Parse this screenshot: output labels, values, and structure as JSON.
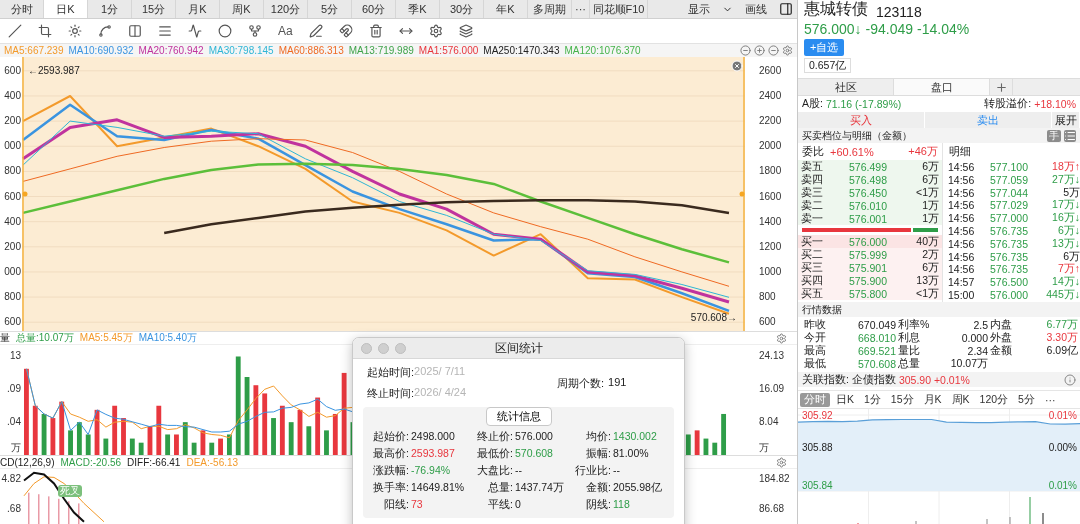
{
  "top_tabs": {
    "tabs": [
      {
        "label": "分时",
        "selected": false,
        "kind": "period"
      },
      {
        "label": "日K",
        "selected": true,
        "kind": "period"
      },
      {
        "label": "1分",
        "selected": false,
        "kind": "period"
      },
      {
        "label": "15分",
        "selected": false,
        "kind": "period"
      },
      {
        "label": "月K",
        "selected": false,
        "kind": "period"
      },
      {
        "label": "周K",
        "selected": false,
        "kind": "period"
      },
      {
        "label": "120分",
        "selected": false,
        "kind": "period"
      },
      {
        "label": "5分",
        "selected": false,
        "kind": "period"
      },
      {
        "label": "60分",
        "selected": false,
        "kind": "period"
      },
      {
        "label": "季K",
        "selected": false,
        "kind": "period"
      },
      {
        "label": "30分",
        "selected": false,
        "kind": "period"
      },
      {
        "label": "年K",
        "selected": false,
        "kind": "period"
      },
      {
        "label": "多周期",
        "selected": false,
        "kind": "period"
      },
      {
        "label": "···",
        "selected": false,
        "kind": "more"
      },
      {
        "label": "同花顺F10",
        "selected": false,
        "kind": "link"
      }
    ],
    "display_menu": "显示",
    "draw_lines": "画线"
  },
  "drawing_tools": {
    "text_tool": "Aa"
  },
  "ma_legend": [
    "MA5:667.239",
    "MA10:690.932",
    "MA20:760.942",
    "MA30:798.145",
    "MA60:886.313",
    "MA13:719.989",
    "MA1:576.000",
    "MA250:1470.343",
    "MA120:1076.370"
  ],
  "main_chart": {
    "left_axis_labels": [
      "600",
      "400",
      "200",
      "000",
      "800",
      "600",
      "400",
      "200",
      "000",
      "800",
      "600"
    ],
    "chart_data": {
      "type": "line",
      "grid": true,
      "ylim": [
        530,
        2710
      ],
      "yticks": [
        600,
        800,
        1000,
        1200,
        1400,
        1600,
        1800,
        2000,
        2200,
        2400,
        2600
      ],
      "series": [
        {
          "color": "#f39a2b",
          "values": [
            2200,
            2400,
            2000,
            2070,
            2140,
            2000,
            1820,
            1560,
            1470,
            1330,
            1130,
            1300,
            950,
            940,
            800,
            667
          ]
        },
        {
          "color": "#3a94e0",
          "values": [
            2050,
            2330,
            2080,
            2050,
            2130,
            2060,
            1850,
            1640,
            1500,
            1380,
            1250,
            1260,
            990,
            960,
            830,
            691
          ]
        },
        {
          "color": "#c0339e",
          "values": [
            1900,
            2150,
            2210,
            2070,
            2080,
            2100,
            2000,
            1800,
            1620,
            1500,
            1300,
            1260,
            1000,
            970,
            870,
            761
          ]
        },
        {
          "color": "#2fb6d6",
          "values": [
            1850,
            2200,
            2150,
            2080,
            2120,
            2100,
            1900,
            1750,
            1560,
            1450,
            1300,
            1250,
            1010,
            980,
            900,
            798
          ]
        },
        {
          "color": "#ef6a23",
          "values": [
            1720,
            1820,
            1920,
            1990,
            2040,
            2060,
            2050,
            1950,
            1800,
            1620,
            1470,
            1360,
            1260,
            1120,
            1000,
            886
          ]
        },
        {
          "color": "#5cbf3a",
          "values": [
            1470,
            1560,
            1650,
            1740,
            1810,
            1855,
            1860,
            1850,
            1820,
            1770,
            1700,
            1560,
            1430,
            1300,
            1180,
            1076
          ]
        },
        {
          "color": "#3a2a1e",
          "values": [
            null,
            null,
            null,
            1310,
            1380,
            1430,
            1480,
            1510,
            1535,
            1555,
            1565,
            1570,
            1570,
            1560,
            1530,
            1470
          ]
        }
      ],
      "annotations": [
        "←2593.987",
        "570.608→"
      ]
    }
  },
  "volume": {
    "title": "量",
    "legend": [
      "总量:10.07万",
      "MA5:5.45万",
      "MA10:5.40万"
    ],
    "left_axis_labels": [
      "13",
      ".09",
      ".04",
      "万"
    ],
    "right_axis_labels": [
      "24.13",
      "16.09",
      "8.04",
      "万"
    ]
  },
  "macd": {
    "title": "CD(12,26,9)",
    "legend": [
      "MACD:-20.56",
      "DIFF:-66.41",
      "DEA:-56.13"
    ],
    "left_axis_labels": [
      "4.82",
      ".68"
    ],
    "right_axis_labels": [
      "184.82",
      "86.68"
    ],
    "signal_badge": "死叉"
  },
  "interval_dialog": {
    "title": "区间统计",
    "start_label": "起始时间:",
    "start_value": "2025/ 7/11",
    "end_label": "终止时间:",
    "end_value": "2026/ 4/24",
    "count_label": "周期个数:",
    "count_value": "191",
    "stats_button": "统计信息",
    "rows": [
      {
        "cells": [
          {
            "label": "起始价:",
            "value": "2498.000",
            "kind": "flat"
          },
          {
            "label": "终止价:",
            "value": "576.000",
            "kind": "flat"
          },
          {
            "label": "均价:",
            "value": "1430.002",
            "kind": "down"
          }
        ]
      },
      {
        "cells": [
          {
            "label": "最高价:",
            "value": "2593.987",
            "kind": "up"
          },
          {
            "label": "最低价:",
            "value": "570.608",
            "kind": "down"
          },
          {
            "label": "振幅:",
            "value": "81.00%",
            "kind": "flat"
          }
        ]
      },
      {
        "cells": [
          {
            "label": "涨跌幅:",
            "value": "-76.94%",
            "kind": "down"
          },
          {
            "label": "大盘比:",
            "value": "--",
            "kind": "flat"
          },
          {
            "label": "行业比:",
            "value": "--",
            "kind": "flat"
          }
        ]
      },
      {
        "cells": [
          {
            "label": "换手率:",
            "value": "14649.81%",
            "kind": "flat"
          },
          {
            "label": "总量:",
            "value": "1437.74万",
            "kind": "flat"
          },
          {
            "label": "金额:",
            "value": "2055.98亿",
            "kind": "flat"
          }
        ]
      },
      {
        "cells": [
          {
            "label": "阳线:",
            "value": "73",
            "kind": "up"
          },
          {
            "label": "平线:",
            "value": "0",
            "kind": "flat"
          },
          {
            "label": "阴线:",
            "value": "118",
            "kind": "down"
          }
        ]
      }
    ]
  },
  "quote": {
    "name": "惠城转债",
    "code": "123118",
    "price": {
      "value": "576.000↓",
      "change": "-94.049",
      "pct": "-14.04%",
      "kind": "down"
    },
    "watch_button": "+自选",
    "market_cap": "0.657亿",
    "tabs": [
      {
        "label": "社区",
        "selected": false
      },
      {
        "label": "盘口",
        "selected": true
      }
    ],
    "stock_line": {
      "label": "A股:",
      "value": "71.16 (-17.89%)",
      "kind": "down"
    },
    "premium": {
      "label": "转股溢价:",
      "value": "+18.10%",
      "kind": "up"
    },
    "trade_buttons": [
      {
        "label": "买入",
        "kind": "buy"
      },
      {
        "label": "卖出",
        "kind": "sell"
      },
      {
        "label": "展开",
        "kind": "plain"
      }
    ],
    "book_title": "买卖档位与明细（金额）",
    "lot_toggle": "手",
    "order_ratio": {
      "label": "委比",
      "pct": "+60.61%",
      "amount": "+46万",
      "kind": "up"
    },
    "detail_title": "明细",
    "asks": [
      {
        "label": "卖五",
        "price": "576.499",
        "volume": "6万"
      },
      {
        "label": "卖四",
        "price": "576.498",
        "volume": "6万"
      },
      {
        "label": "卖三",
        "price": "576.450",
        "volume": "<1万"
      },
      {
        "label": "卖二",
        "price": "576.010",
        "volume": "1万"
      },
      {
        "label": "卖一",
        "price": "576.001",
        "volume": "1万"
      }
    ],
    "bid_share": {
      "level": 0.8
    },
    "bids": [
      {
        "label": "买一",
        "price": "576.000",
        "volume": "40万"
      },
      {
        "label": "买二",
        "price": "575.999",
        "volume": "2万"
      },
      {
        "label": "买三",
        "price": "575.901",
        "volume": "6万"
      },
      {
        "label": "买四",
        "price": "575.900",
        "volume": "13万"
      },
      {
        "label": "买五",
        "price": "575.800",
        "volume": "<1万"
      }
    ],
    "trades": [
      {
        "time": "14:56",
        "price": "577.100",
        "volume": "18万",
        "arrow": "↑",
        "kind": "up"
      },
      {
        "time": "14:56",
        "price": "577.059",
        "volume": "27万",
        "arrow": "↓",
        "kind": "down"
      },
      {
        "time": "14:56",
        "price": "577.044",
        "volume": "5万",
        "kind": "flat"
      },
      {
        "time": "14:56",
        "price": "577.029",
        "volume": "17万",
        "arrow": "↓",
        "kind": "down"
      },
      {
        "time": "14:56",
        "price": "577.000",
        "volume": "16万",
        "arrow": "↓",
        "kind": "down"
      },
      {
        "time": "14:56",
        "price": "576.735",
        "volume": "6万",
        "arrow": "↓",
        "kind": "down"
      },
      {
        "time": "14:56",
        "price": "576.735",
        "volume": "13万",
        "arrow": "↓",
        "kind": "down"
      },
      {
        "time": "14:56",
        "price": "576.735",
        "volume": "6万",
        "kind": "flat"
      },
      {
        "time": "14:56",
        "price": "576.735",
        "volume": "7万",
        "arrow": "↑",
        "kind": "up"
      },
      {
        "time": "14:57",
        "price": "576.500",
        "volume": "14万",
        "arrow": "↓",
        "kind": "down"
      },
      {
        "time": "15:00",
        "price": "576.000",
        "volume": "445万",
        "arrow": "↓",
        "kind": "down"
      }
    ],
    "market_title": "行情数据",
    "market_rows": [
      {
        "cells": [
          {
            "label": "昨收",
            "value": "670.049",
            "kind": "flat"
          },
          {
            "label": "利率%",
            "value": "2.5",
            "kind": "flat"
          },
          {
            "label": "内盘",
            "value": "6.77万",
            "kind": "down"
          }
        ]
      },
      {
        "cells": [
          {
            "label": "今开",
            "value": "668.010",
            "kind": "down"
          },
          {
            "label": "利息",
            "value": "0.000",
            "kind": "flat"
          },
          {
            "label": "外盘",
            "value": "3.30万",
            "kind": "up"
          }
        ]
      },
      {
        "cells": [
          {
            "label": "最高",
            "value": "669.521",
            "kind": "down"
          },
          {
            "label": "量比",
            "value": "2.34",
            "kind": "flat"
          },
          {
            "label": "金额",
            "value": "6.09亿",
            "kind": "flat"
          }
        ]
      },
      {
        "cells": [
          {
            "label": "最低",
            "value": "570.608",
            "kind": "down"
          },
          {
            "label": "总量",
            "value": "10.07万",
            "kind": "flat"
          }
        ]
      }
    ],
    "index_line": {
      "label": "关联指数:",
      "name": "企债指数",
      "value": "305.90 +0.01%",
      "kind": "up"
    },
    "mini_tabs": [
      {
        "label": "分时",
        "selected": true
      },
      {
        "label": "日K",
        "selected": false
      },
      {
        "label": "1分",
        "selected": false
      },
      {
        "label": "15分",
        "selected": false
      },
      {
        "label": "月K",
        "selected": false
      },
      {
        "label": "周K",
        "selected": false
      },
      {
        "label": "120分",
        "selected": false
      },
      {
        "label": "5分",
        "selected": false
      },
      {
        "label": "···",
        "selected": false
      }
    ],
    "mini_chart": {
      "left_labels": [
        {
          "text": "305.92",
          "kind": "up"
        },
        {
          "text": "305.88",
          "kind": "flat"
        },
        {
          "text": "305.84",
          "kind": "down"
        }
      ],
      "right_labels": [
        {
          "text": "0.01%",
          "kind": "up"
        },
        {
          "text": "0.00%",
          "kind": "flat"
        },
        {
          "text": "0.01%",
          "kind": "down"
        }
      ]
    }
  }
}
